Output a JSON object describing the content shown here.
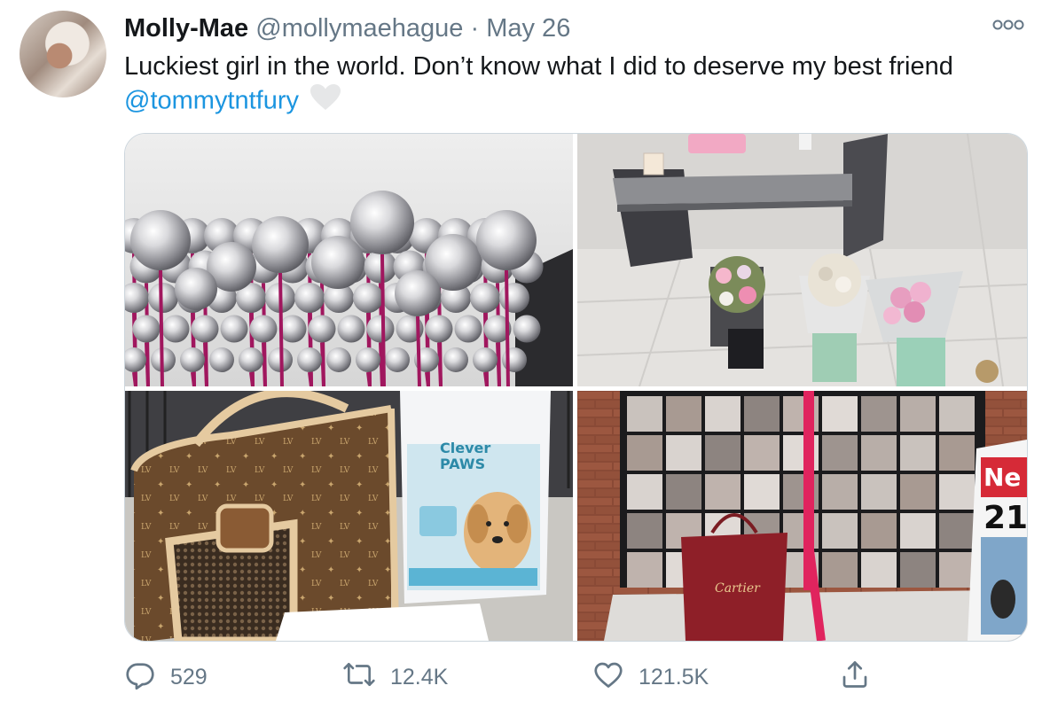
{
  "tweet": {
    "display_name": "Molly-Mae",
    "handle": "@mollymaehague",
    "separator": "·",
    "date": "May 26",
    "text": "Luckiest girl in the world. Don’t know what I did to deserve my best friend",
    "mention": "@tommytntfury"
  },
  "media": {
    "count": 4,
    "cartier_text": "Cartier",
    "newspaper_text": "Ne",
    "newspaper_number": "21"
  },
  "actions": {
    "replies": "529",
    "retweets": "12.4K",
    "likes": "121.5K"
  },
  "icons": [
    "more-icon",
    "white-heart-emoji-icon",
    "reply-icon",
    "retweet-icon",
    "like-icon",
    "share-icon"
  ],
  "colors": {
    "mention": "#1b95e0",
    "secondary": "#657786",
    "text": "#14171a"
  }
}
